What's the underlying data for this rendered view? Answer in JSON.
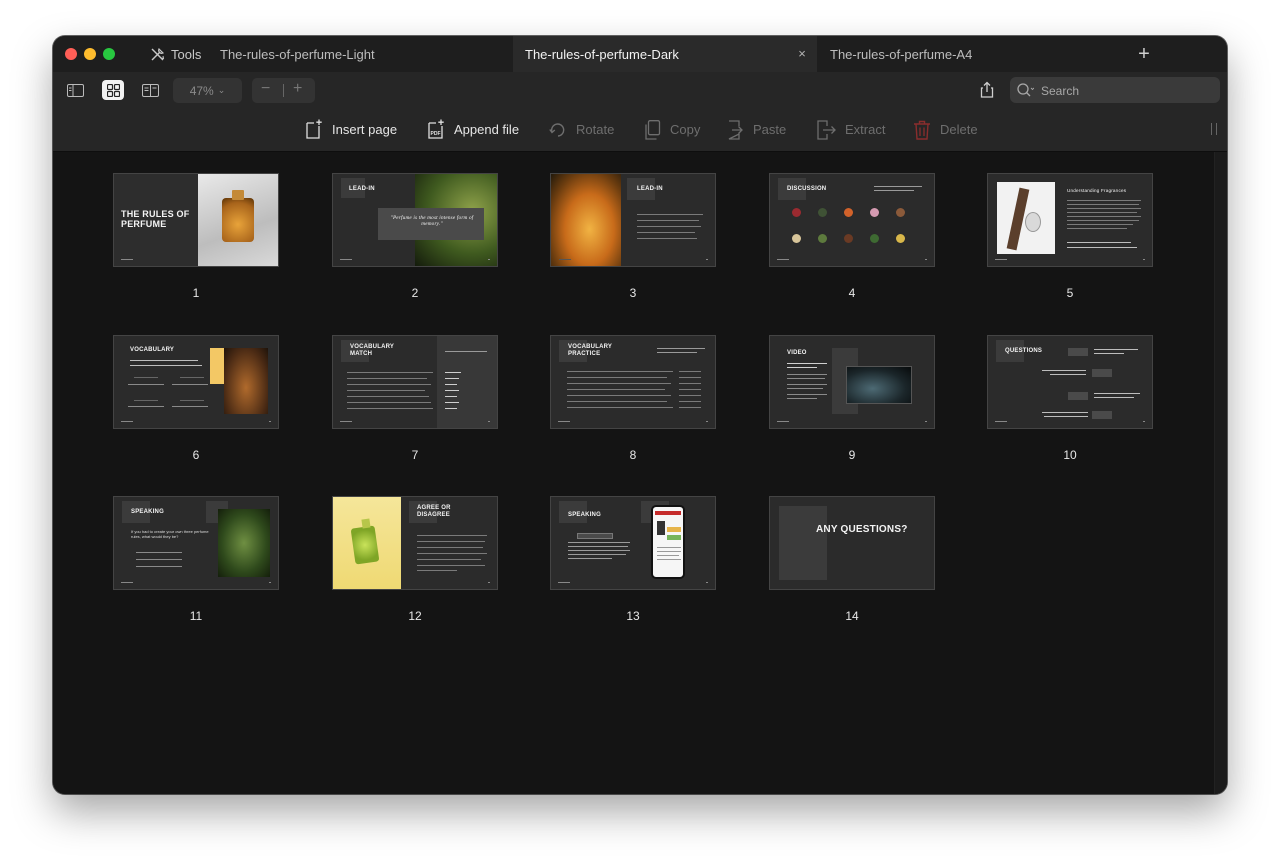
{
  "tabbar": {
    "tools_label": "Tools",
    "tabs": [
      {
        "label": "The-rules-of-perfume-Light"
      },
      {
        "label": "The-rules-of-perfume-Dark"
      },
      {
        "label": "The-rules-of-perfume-A4"
      }
    ],
    "close_glyph": "×",
    "add_glyph": "+"
  },
  "toolbar": {
    "zoom_value": "47%",
    "zoom_minus": "−",
    "zoom_plus": "+",
    "search_placeholder": "Search"
  },
  "actions": [
    {
      "label": "Insert page",
      "enabled": true
    },
    {
      "label": "Append file",
      "enabled": true
    },
    {
      "label": "Rotate",
      "enabled": false
    },
    {
      "label": "Copy",
      "enabled": false
    },
    {
      "label": "Paste",
      "enabled": false
    },
    {
      "label": "Extract",
      "enabled": false
    },
    {
      "label": "Delete",
      "enabled": false
    }
  ],
  "pages": [
    {
      "number": "1",
      "title": "THE RULES OF PERFUME"
    },
    {
      "number": "2",
      "title": "LEAD-IN",
      "quote": "\"Perfume is the most intense form of memory.\""
    },
    {
      "number": "3",
      "title": "LEAD-IN"
    },
    {
      "number": "4",
      "title": "DISCUSSION"
    },
    {
      "number": "5",
      "title": "Understanding Fragrances"
    },
    {
      "number": "6",
      "title": "VOCABULARY"
    },
    {
      "number": "7",
      "title": "VOCABULARY MATCH"
    },
    {
      "number": "8",
      "title": "VOCABULARY PRACTICE"
    },
    {
      "number": "9",
      "title": "VIDEO"
    },
    {
      "number": "10",
      "title": "QUESTIONS"
    },
    {
      "number": "11",
      "title": "SPEAKING",
      "prompt": "If you had to create your own three perfume rules, what would they be?"
    },
    {
      "number": "12",
      "title": "AGREE OR DISAGREE"
    },
    {
      "number": "13",
      "title": "SPEAKING"
    },
    {
      "number": "14",
      "title": "ANY QUESTIONS?"
    }
  ],
  "colors": {
    "window_bg": "#141414",
    "toolbar_bg": "#262626",
    "active_tab_bg": "#2a2a2a",
    "traffic_red": "#ff5f57",
    "traffic_yellow": "#febc2e",
    "traffic_green": "#28c840",
    "delete_icon": "#8a2d2d"
  }
}
